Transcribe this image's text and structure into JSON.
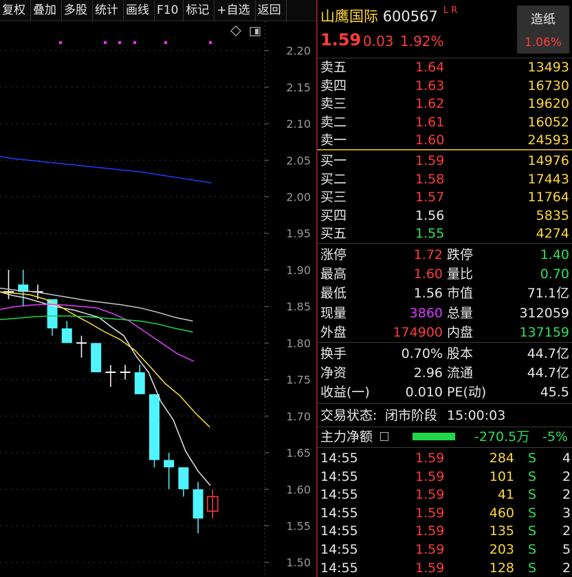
{
  "toolbar": [
    "复权",
    "叠加",
    "多股",
    "统计",
    "画线",
    "F10",
    "标记",
    "+自选",
    "返回"
  ],
  "header": {
    "name": "山鹰国际",
    "code": "600567",
    "flags": "L R",
    "price": "1.59",
    "change": "0.03",
    "pct": "1.92%",
    "sector": "造纸",
    "sector_pct": "1.06%"
  },
  "sell": [
    {
      "label": "卖五",
      "price": "1.64",
      "vol": "13493"
    },
    {
      "label": "卖四",
      "price": "1.63",
      "vol": "16730"
    },
    {
      "label": "卖三",
      "price": "1.62",
      "vol": "19620"
    },
    {
      "label": "卖二",
      "price": "1.61",
      "vol": "16052"
    },
    {
      "label": "卖一",
      "price": "1.60",
      "vol": "24593"
    }
  ],
  "buy": [
    {
      "label": "买一",
      "price": "1.59",
      "vol": "14976"
    },
    {
      "label": "买二",
      "price": "1.58",
      "vol": "17443"
    },
    {
      "label": "买三",
      "price": "1.57",
      "vol": "11764"
    },
    {
      "label": "买四",
      "price": "1.56",
      "vol": "5835"
    },
    {
      "label": "买五",
      "price": "1.55",
      "vol": "4274"
    }
  ],
  "stats1": [
    {
      "l1": "涨停",
      "v1": "1.72",
      "l2": "跌停",
      "v2": "1.40"
    },
    {
      "l1": "最高",
      "v1": "1.60",
      "l2": "量比",
      "v2": "0.70"
    },
    {
      "l1": "最低",
      "v1": "1.56",
      "l2": "市值",
      "v2": "71.1亿"
    },
    {
      "l1": "现量",
      "v1": "3860",
      "l2": "总量",
      "v2": "312059"
    },
    {
      "l1": "外盘",
      "v1": "174900",
      "l2": "内盘",
      "v2": "137159"
    }
  ],
  "stats2": [
    {
      "l1": "换手",
      "v1": "0.70%",
      "l2": "股本",
      "v2": "44.7亿"
    },
    {
      "l1": "净资",
      "v1": "2.96",
      "l2": "流通",
      "v2": "44.7亿"
    },
    {
      "l1": "收益(一)",
      "v1": "0.010",
      "l2": "PE(动)",
      "v2": "45.5"
    }
  ],
  "status": {
    "label": "交易状态:",
    "value": "闭市阶段",
    "time": "15:00:03"
  },
  "mainflow": {
    "label": "主力净额",
    "amount": "-270.5万",
    "pct": "-5%"
  },
  "ticks": [
    {
      "t": "14:55",
      "p": "1.59",
      "v": "284",
      "s": "S",
      "n": "4"
    },
    {
      "t": "14:55",
      "p": "1.59",
      "v": "101",
      "s": "S",
      "n": "2"
    },
    {
      "t": "14:55",
      "p": "1.59",
      "v": "41",
      "s": "S",
      "n": "2"
    },
    {
      "t": "14:55",
      "p": "1.59",
      "v": "460",
      "s": "S",
      "n": "3"
    },
    {
      "t": "14:55",
      "p": "1.59",
      "v": "135",
      "s": "S",
      "n": "2"
    },
    {
      "t": "14:55",
      "p": "1.59",
      "v": "203",
      "s": "S",
      "n": "5"
    },
    {
      "t": "14:55",
      "p": "1.59",
      "v": "128",
      "s": "S",
      "n": "2"
    }
  ],
  "chart_data": {
    "type": "candlestick",
    "ylim": [
      1.48,
      2.24
    ],
    "y_ticks": [
      "2.20",
      "2.15",
      "2.10",
      "2.05",
      "2.00",
      "1.95",
      "1.90",
      "1.85",
      "1.80",
      "1.75",
      "1.70",
      "1.65",
      "1.60",
      "1.55",
      "1.50"
    ],
    "y_tick_values": [
      2.2,
      2.15,
      2.1,
      2.05,
      2.0,
      1.95,
      1.9,
      1.85,
      1.8,
      1.75,
      1.7,
      1.65,
      1.6,
      1.55,
      1.5
    ],
    "candles": [
      {
        "o": 1.87,
        "h": 1.9,
        "l": 1.86,
        "c": 1.87
      },
      {
        "o": 1.88,
        "h": 1.9,
        "l": 1.85,
        "c": 1.87
      },
      {
        "o": 1.87,
        "h": 1.88,
        "l": 1.86,
        "c": 1.87
      },
      {
        "o": 1.86,
        "h": 1.86,
        "l": 1.81,
        "c": 1.82
      },
      {
        "o": 1.82,
        "h": 1.83,
        "l": 1.8,
        "c": 1.8
      },
      {
        "o": 1.8,
        "h": 1.81,
        "l": 1.78,
        "c": 1.8
      },
      {
        "o": 1.8,
        "h": 1.8,
        "l": 1.76,
        "c": 1.76
      },
      {
        "o": 1.76,
        "h": 1.77,
        "l": 1.74,
        "c": 1.76
      },
      {
        "o": 1.76,
        "h": 1.77,
        "l": 1.75,
        "c": 1.76
      },
      {
        "o": 1.76,
        "h": 1.77,
        "l": 1.73,
        "c": 1.73
      },
      {
        "o": 1.73,
        "h": 1.73,
        "l": 1.63,
        "c": 1.64
      },
      {
        "o": 1.64,
        "h": 1.65,
        "l": 1.6,
        "c": 1.63
      },
      {
        "o": 1.63,
        "h": 1.63,
        "l": 1.59,
        "c": 1.6
      },
      {
        "o": 1.6,
        "h": 1.61,
        "l": 1.54,
        "c": 1.56
      },
      {
        "o": 1.57,
        "h": 1.6,
        "l": 1.56,
        "c": 1.59
      }
    ],
    "ma_lines": [
      {
        "color": "#1e3cff",
        "points": [
          2.055,
          2.052,
          2.05,
          2.048,
          2.046,
          2.044,
          2.042,
          2.04,
          2.038,
          2.036,
          2.034,
          2.031,
          2.028,
          2.025,
          2.022,
          2.019
        ]
      },
      {
        "color": "#e6e6e6",
        "points": [
          1.87,
          1.865,
          1.862,
          1.857,
          1.852,
          1.848,
          1.845,
          1.84,
          1.835,
          1.822,
          1.81,
          1.782,
          1.76,
          1.72,
          1.695,
          1.652,
          1.625,
          1.605
        ]
      },
      {
        "color": "#ffe23a",
        "points": [
          1.87,
          1.868,
          1.866,
          1.86,
          1.85,
          1.838,
          1.827,
          1.815,
          1.805,
          1.79,
          1.768,
          1.745,
          1.728,
          1.705,
          1.685
        ]
      },
      {
        "color": "#e040ff",
        "points": [
          1.846,
          1.85,
          1.852,
          1.853,
          1.852,
          1.85,
          1.848,
          1.84,
          1.83,
          1.815,
          1.8,
          1.785,
          1.775
        ]
      },
      {
        "color": "#1fd64a",
        "points": [
          1.832,
          1.834,
          1.836,
          1.837,
          1.837,
          1.836,
          1.834,
          1.832,
          1.83,
          1.826,
          1.82,
          1.815
        ]
      },
      {
        "color": "#c8c8c8",
        "points": [
          1.875,
          1.872,
          1.87,
          1.866,
          1.862,
          1.858,
          1.855,
          1.852,
          1.848,
          1.842,
          1.835,
          1.83
        ]
      }
    ],
    "grid": true
  }
}
